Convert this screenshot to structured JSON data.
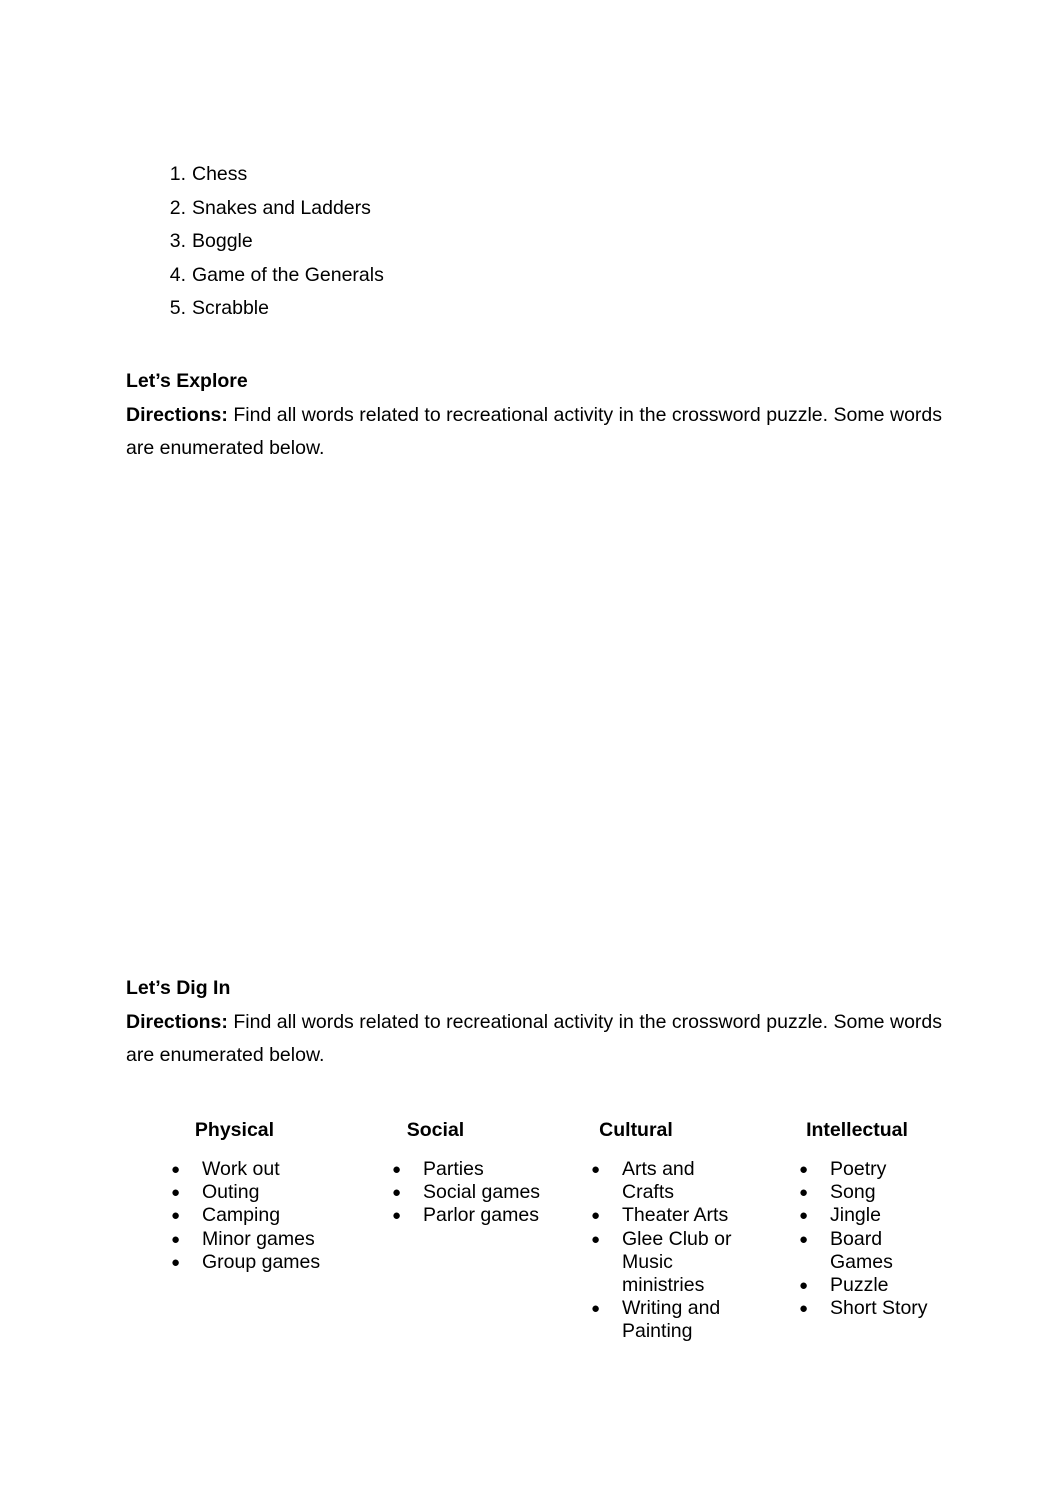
{
  "document": {
    "background_color": "#ffffff",
    "text_color": "#000000"
  },
  "numbered_list": {
    "items": [
      {
        "num": "1.",
        "label": "Chess"
      },
      {
        "num": "2.",
        "label": "Snakes and Ladders"
      },
      {
        "num": "3.",
        "label": "Boggle"
      },
      {
        "num": "4.",
        "label": "Game of the Generals"
      },
      {
        "num": "5.",
        "label": "Scrabble"
      }
    ]
  },
  "explore_section": {
    "title": "Let’s Explore",
    "directions_label": "Directions:",
    "directions_text": " Find all words related to recreational activity in the crossword puzzle. Some words are enumerated below."
  },
  "digin_section": {
    "title": "Let’s Dig In",
    "directions_label": "Directions:",
    "directions_text": " Find all words related to recreational activity in the crossword puzzle. Some words are enumerated below."
  },
  "categories": {
    "bullet_glyph": "●",
    "columns": [
      {
        "heading": "Physical",
        "items": [
          "Work out",
          "Outing",
          "Camping",
          "Minor games",
          "Group games"
        ]
      },
      {
        "heading": "Social",
        "items": [
          "Parties",
          "Social games",
          "Parlor games"
        ]
      },
      {
        "heading": "Cultural",
        "items": [
          "Arts and Crafts",
          "Theater Arts",
          "Glee Club or Music ministries",
          "Writing and Painting"
        ]
      },
      {
        "heading": "Intellectual",
        "items": [
          "Poetry",
          "Song",
          "Jingle",
          "Board Games",
          "Puzzle",
          "Short Story"
        ]
      }
    ]
  }
}
